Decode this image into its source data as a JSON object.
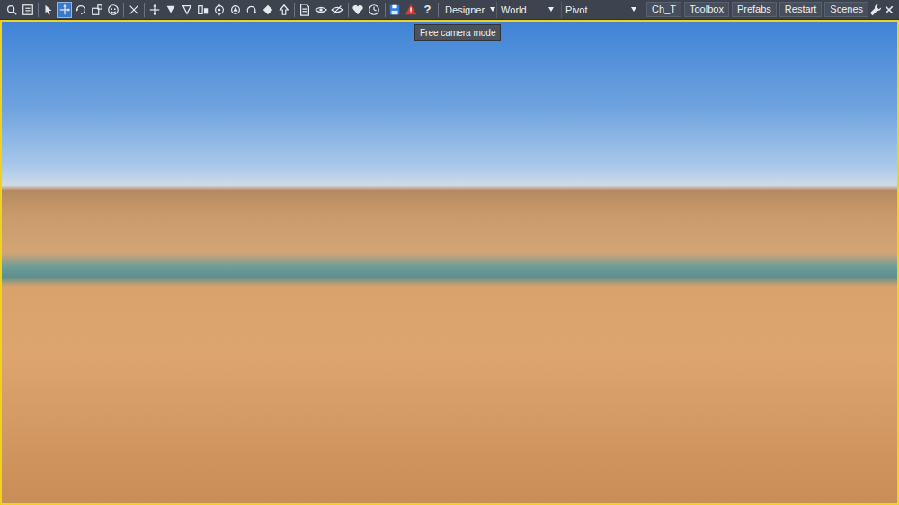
{
  "toolbar": {
    "tool_groups": [
      [
        {
          "selected": false
        },
        {
          "selected": false
        }
      ],
      [
        {
          "selected": false
        },
        {
          "selected": true
        },
        {
          "selected": false
        },
        {
          "selected": false
        },
        {
          "selected": false
        }
      ],
      [
        {
          "selected": false
        }
      ],
      [
        {
          "selected": false
        },
        {
          "selected": false
        },
        {
          "selected": false
        },
        {
          "selected": false
        },
        {
          "selected": false
        },
        {
          "selected": false
        },
        {
          "selected": false
        },
        {
          "selected": false
        },
        {
          "selected": false
        }
      ],
      [
        {
          "selected": false
        },
        {
          "selected": false
        },
        {
          "selected": false
        }
      ],
      [
        {
          "selected": false
        },
        {
          "selected": false
        }
      ],
      [
        {
          "selected": false
        },
        {
          "selected": false
        },
        {
          "selected": false,
          "glyph": "?"
        }
      ]
    ],
    "dropdowns": [
      {
        "label": "Designer"
      },
      {
        "label": "World"
      },
      {
        "label": "Pivot"
      }
    ],
    "right_buttons": [
      {
        "label": "Ch_T"
      },
      {
        "label": "Toolbox"
      },
      {
        "label": "Prefabs"
      },
      {
        "label": "Restart"
      },
      {
        "label": "Scenes"
      }
    ]
  },
  "tooltip": {
    "text": "Free camera mode"
  }
}
